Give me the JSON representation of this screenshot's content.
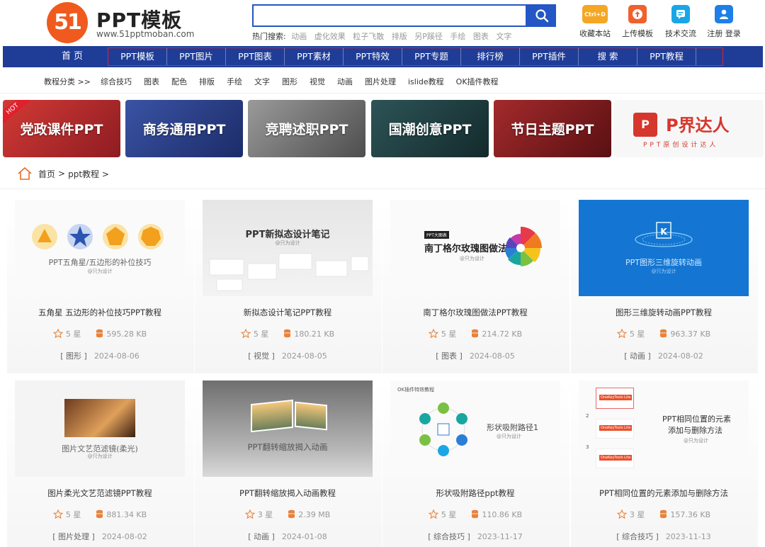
{
  "header": {
    "logo_mark": "51",
    "logo_title": "PPT模板",
    "logo_url": "www.51pptmoban.com",
    "search_value": "",
    "hot_label": "热门搜索:",
    "hot_items": [
      "动画",
      "虚化效果",
      "粒子飞散",
      "排版",
      "另P蹊径",
      "手绘",
      "图表",
      "文字"
    ],
    "tools": [
      {
        "label": "收藏本站",
        "icon": "ctrl-d-icon",
        "icon_text": "Ctrl+D",
        "color": "#f5a623"
      },
      {
        "label": "上传模板",
        "icon": "upload-cloud-icon",
        "color": "#f0612d"
      },
      {
        "label": "技术交流",
        "icon": "chat-icon",
        "color": "#1aa6e6"
      },
      {
        "label": "注册 登录",
        "icon": "user-icon",
        "color": "#1e7fe8"
      }
    ]
  },
  "nav": {
    "home": "首页",
    "items": [
      "PPT模板",
      "PPT图片",
      "PPT图表",
      "PPT素材",
      "PPT特效",
      "PPT专题",
      "排行榜",
      "PPT插件",
      "搜 索",
      "PPT教程"
    ]
  },
  "subnav": {
    "title": "教程分类 >>",
    "items": [
      "综合技巧",
      "图表",
      "配色",
      "排版",
      "手绘",
      "文字",
      "图形",
      "视觉",
      "动画",
      "图片处理",
      "islide教程",
      "OK插件教程"
    ]
  },
  "banners": [
    {
      "label": "党政课件PPT",
      "badge": "HOT",
      "bg": "#b5272c"
    },
    {
      "label": "商务通用PPT",
      "bg": "#2a3f86"
    },
    {
      "label": "竞聘述职PPT",
      "bg": "#6f6f6f"
    },
    {
      "label": "国潮创意PPT",
      "bg": "#1f3c3f"
    },
    {
      "label": "节日主题PPT",
      "bg": "#7a1a1c"
    }
  ],
  "brand_banner": {
    "mark": "P",
    "name": "P界达人",
    "sub": "PPT原创设计达人"
  },
  "breadcrumb": {
    "home": "首页",
    "sep": ">",
    "current": "ppt教程 >"
  },
  "cards": [
    {
      "title": "五角星 五边形的补位技巧PPT教程",
      "stars": "5 星",
      "size": "595.28 KB",
      "category": "[ 图形 ]",
      "date": "2024-08-06",
      "thumb_caption": "PPT五角星/五边形的补位技巧",
      "thumb_sub": "@只为设计"
    },
    {
      "title": "新拟态设计笔记PPT教程",
      "stars": "5 星",
      "size": "180.21 KB",
      "category": "[ 视觉 ]",
      "date": "2024-08-05",
      "thumb_caption": "PPT新拟态设计笔记",
      "thumb_sub": "@只为设计"
    },
    {
      "title": "南丁格尔玫瑰图做法PPT教程",
      "stars": "5 星",
      "size": "214.72 KB",
      "category": "[ 图表 ]",
      "date": "2024-08-05",
      "thumb_caption": "南丁格尔玫瑰图做法",
      "thumb_sub": "@只为设计",
      "thumb_tag": "PPT大图表"
    },
    {
      "title": "图形三维旋转动画PPT教程",
      "stars": "5 星",
      "size": "963.37 KB",
      "category": "[ 动画 ]",
      "date": "2024-08-02",
      "thumb_caption": "PPT图形三维旋转动画",
      "thumb_sub": "@只为设计"
    },
    {
      "title": "图片柔光文艺范滤镜PPT教程",
      "stars": "5 星",
      "size": "881.34 KB",
      "category": "[ 图片处理 ]",
      "date": "2024-08-02",
      "thumb_caption": "图片文艺范滤镜(柔光)",
      "thumb_sub": "@只为设计"
    },
    {
      "title": "PPT翻转缩放揭入动画教程",
      "stars": "3 星",
      "size": "2.39 MB",
      "category": "[ 动画 ]",
      "date": "2024-01-08",
      "thumb_caption": "PPT翻转缩放揭入动画",
      "thumb_sub": ""
    },
    {
      "title": "形状吸附路径ppt教程",
      "stars": "5 星",
      "size": "110.86 KB",
      "category": "[ 综合技巧 ]",
      "date": "2023-11-17",
      "thumb_caption": "形状吸附路径1",
      "thumb_sub": "@只为设计",
      "thumb_tag": "OK插件特效教程"
    },
    {
      "title": "PPT相同位置的元素添加与删除方法",
      "stars": "3 星",
      "size": "157.36 KB",
      "category": "[ 综合技巧 ]",
      "date": "2023-11-13",
      "thumb_caption": "PPT相同位置的元素",
      "thumb_caption2": "添加与删除方法",
      "thumb_sub": "@只为设计",
      "thumb_tag": "OneKeyTools Lite"
    }
  ]
}
